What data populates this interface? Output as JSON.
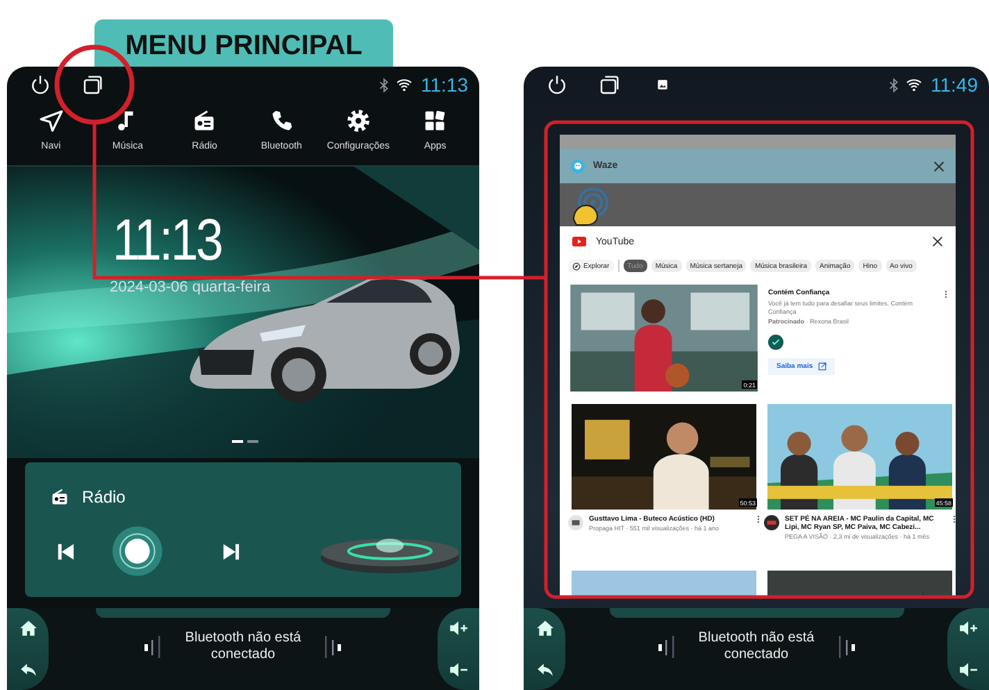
{
  "banner": {
    "title": "MENU PRINCIPAL"
  },
  "screens": [
    {
      "kind": "home",
      "status": {
        "time": "11:13",
        "icons": [
          {
            "kind": "power"
          },
          {
            "kind": "recents"
          }
        ]
      },
      "apps": [
        {
          "label": "Navi",
          "kind": "navigation"
        },
        {
          "label": "Música",
          "kind": "music"
        },
        {
          "label": "Rádio",
          "kind": "radio"
        },
        {
          "label": "Bluetooth",
          "kind": "phone"
        },
        {
          "label": "Configurações",
          "kind": "settings"
        },
        {
          "label": "Apps",
          "kind": "apps"
        }
      ],
      "clock": {
        "time": "11:13",
        "date": "2024-03-06 quarta-feira"
      },
      "pages": [
        {
          "selected": true
        },
        {
          "selected": false
        }
      ],
      "radio": {
        "title": "Rádio"
      },
      "bottom": {
        "status": "Bluetooth não está conectado"
      }
    },
    {
      "kind": "recents",
      "status": {
        "time": "11:49",
        "icons": [
          {
            "kind": "power"
          },
          {
            "kind": "recents"
          },
          {
            "kind": "screenshot"
          }
        ]
      },
      "tasks": [
        {
          "kind": "map",
          "app": "Waze"
        },
        {
          "kind": "video",
          "app": "YouTube",
          "explore": "Explorar",
          "chips": [
            {
              "label": "Tudo",
              "selected": true
            },
            {
              "label": "Música",
              "selected": false
            },
            {
              "label": "Música sertaneja",
              "selected": false
            },
            {
              "label": "Música brasileira",
              "selected": false
            },
            {
              "label": "Animação",
              "selected": false
            },
            {
              "label": "Hino",
              "selected": false
            },
            {
              "label": "Ao vivo",
              "selected": false
            }
          ],
          "ad": {
            "title": "Contém Confiança",
            "description": "Você já tem tudo para desafiar seus limites. Contém Confiança",
            "sponsor": "**Patrocinado** · Rexona Brasil",
            "button": "Saiba mais",
            "duration": "0:21"
          },
          "videos": [
            {
              "title": "Gusttavo Lima - Buteco Acústico (HD)",
              "meta": "Propaga HIT · 551 mil visualizações · há 1 ano",
              "duration": "50:53"
            },
            {
              "title": "SET PÉ NA AREIA - MC Paulin da Capital, MC Lipi, MC Ryan SP, MC Paiva, MC Cabezi...",
              "meta": "PEGA A VISÃO · 2,3 mi de visualizações · há 1 mês",
              "duration": "45:58"
            },
            {
              "kind": "picture"
            },
            {
              "kind": "picture"
            }
          ]
        }
      ],
      "bottom": {
        "status": "Bluetooth não está conectado"
      }
    }
  ]
}
